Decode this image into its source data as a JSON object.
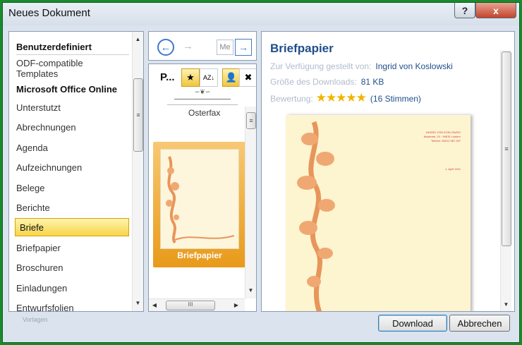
{
  "window": {
    "title": "Neues Dokument",
    "help_label": "?",
    "close_label": "x"
  },
  "sidebar": {
    "items": [
      {
        "label": "Benutzerdefiniert",
        "bold": true
      },
      {
        "label": "ODF-compatible"
      },
      {
        "label": "Templates"
      },
      {
        "label": "Microsoft Office Online",
        "bold": true
      },
      {
        "label": "Unterstutzt"
      },
      {
        "label": "Abrechnungen"
      },
      {
        "label": "Agenda"
      },
      {
        "label": "Aufzeichnungen"
      },
      {
        "label": "Belege"
      },
      {
        "label": "Berichte"
      },
      {
        "label": "Briefe",
        "selected": true
      },
      {
        "label": "Briefpapier"
      },
      {
        "label": "Broschuren"
      },
      {
        "label": "Einladungen"
      },
      {
        "label": "Entwurfsfolien"
      }
    ],
    "footer": "Vorlagen"
  },
  "nav": {
    "back": "←",
    "forward": "→",
    "more": "Me",
    "next": "→"
  },
  "middle": {
    "group_title": "P...",
    "sort_label": "AZ↓",
    "prev_template": "Osterfax",
    "selected_template": "Briefpapier",
    "hscroll_grip": "III"
  },
  "details": {
    "title": "Briefpapier",
    "provided_by_label": "Zur Verfügung gestellt von:",
    "provided_by": "Ingrid von Koslowski",
    "size_label": "Größe des Downloads:",
    "size": "81 KB",
    "rating_label": "Bewertung:",
    "rating_stars": 5,
    "stars_display": "★★★★★",
    "votes": "(16 Stimmen)",
    "preview_sender": "INGRID VON KOSLOWSKI",
    "preview_street": "Musterstr. 20 · 99876 Lindern",
    "preview_phone": "Telefon: 06012 987 297",
    "preview_date": "1. April 2011"
  },
  "buttons": {
    "download": "Download",
    "cancel": "Abbrechen"
  },
  "colors": {
    "accent": "#1f4e8a",
    "selection": "#f7d44a",
    "tile": "#e89a1a",
    "frame": "#1a8a2e"
  }
}
